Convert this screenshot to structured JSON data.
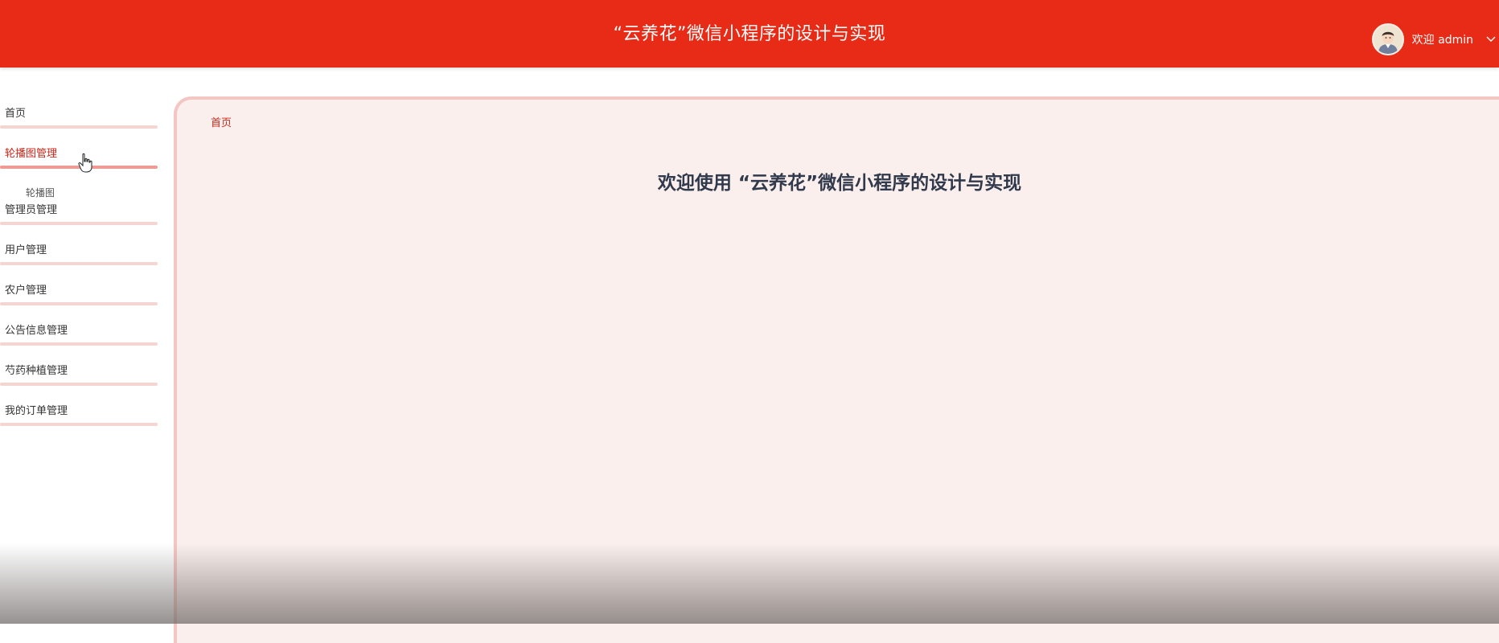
{
  "header": {
    "app_title": "“云养花”微信小程序的设计与实现",
    "welcome_user": "欢迎 admin",
    "chevron_icon": "chevron-down-icon",
    "avatar_icon": "user-avatar",
    "bg_color": "#e82b16"
  },
  "sidebar": {
    "items": [
      {
        "label": "首页"
      },
      {
        "label": "轮播图管理",
        "active": true,
        "children": [
          {
            "label": "轮播图"
          }
        ]
      },
      {
        "label": "管理员管理"
      },
      {
        "label": "用户管理"
      },
      {
        "label": "农户管理"
      },
      {
        "label": "公告信息管理"
      },
      {
        "label": "芍药种植管理"
      },
      {
        "label": "我的订单管理"
      }
    ]
  },
  "main": {
    "breadcrumb": "首页",
    "welcome_heading": "欢迎使用 “云养花”微信小程序的设计与实现"
  },
  "colors": {
    "accent": "#e82b16",
    "active_text": "#c9281a",
    "content_bg": "#faefec",
    "divider": "#f4d5d2"
  }
}
